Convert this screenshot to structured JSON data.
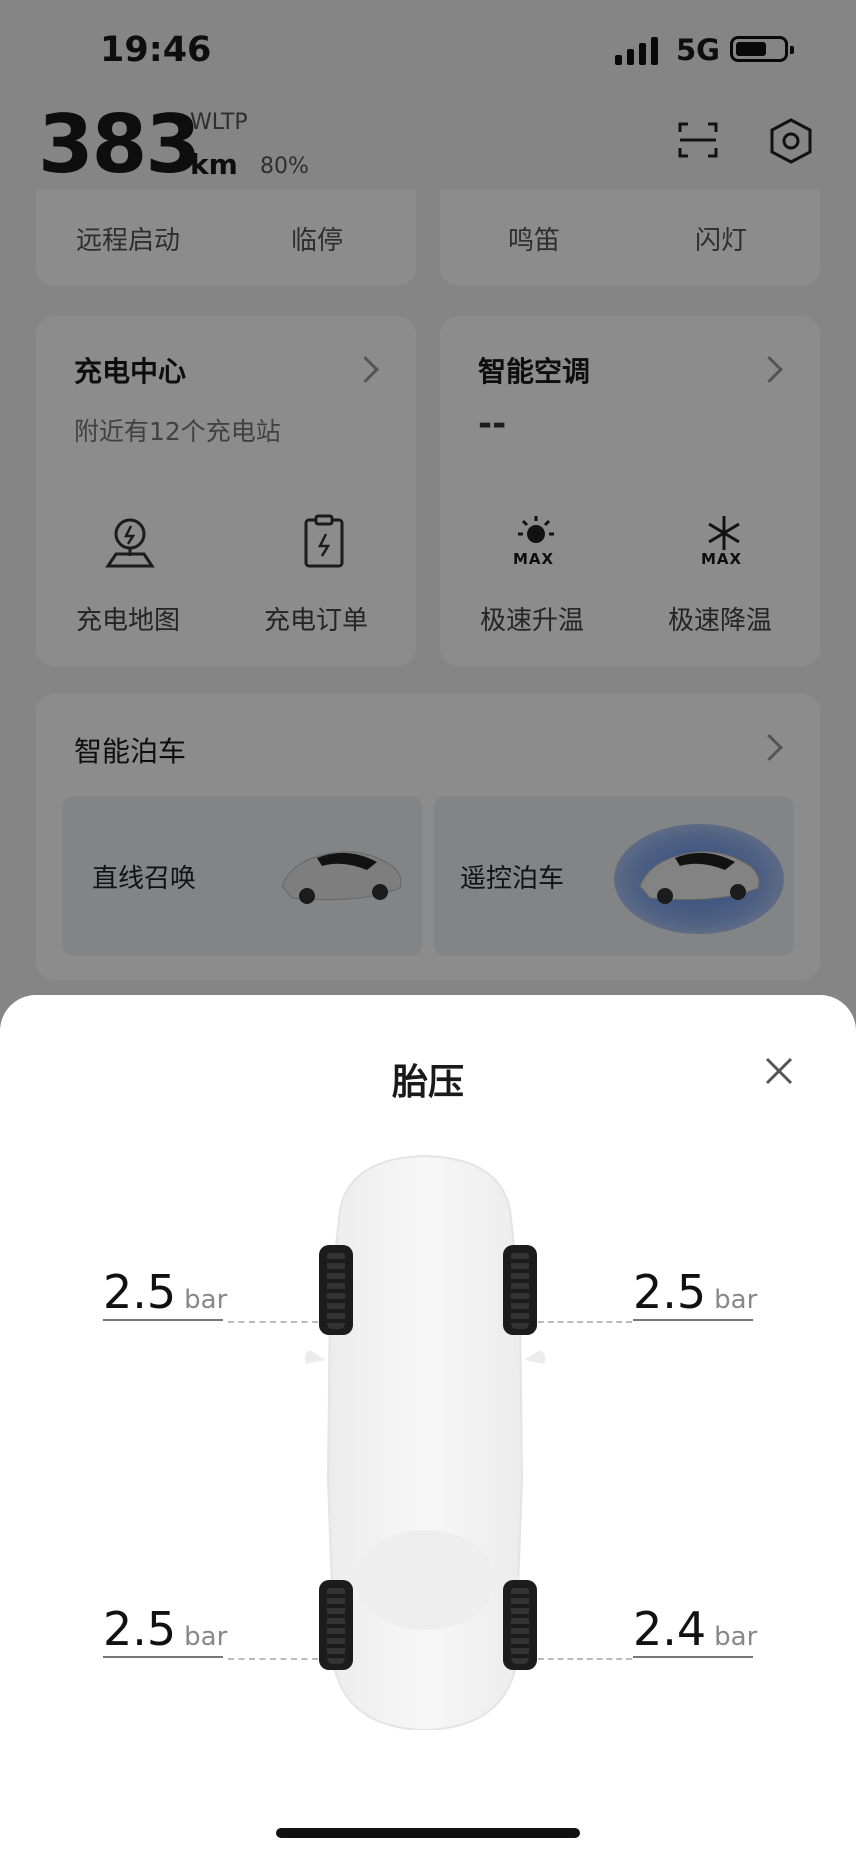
{
  "status_bar": {
    "time": "19:46",
    "network": "5G"
  },
  "header": {
    "range_value": "383",
    "range_unit": "km",
    "range_standard": "WLTP",
    "battery_percent": "80%"
  },
  "remote_controls": {
    "items": [
      "远程启动",
      "临停",
      "鸣笛",
      "闪灯"
    ]
  },
  "charging_card": {
    "title": "充电中心",
    "subtitle": "附近有12个充电站",
    "actions": [
      "充电地图",
      "充电订单"
    ]
  },
  "ac_card": {
    "title": "智能空调",
    "status": "--",
    "actions": [
      "极速升温",
      "极速降温"
    ],
    "badge": "MAX"
  },
  "parking_card": {
    "title": "智能泊车",
    "tiles": [
      "直线召唤",
      "遥控泊车"
    ]
  },
  "tire_sheet": {
    "title": "胎压",
    "unit": "bar",
    "front_left": "2.5",
    "front_right": "2.5",
    "rear_left": "2.5",
    "rear_right": "2.4"
  }
}
